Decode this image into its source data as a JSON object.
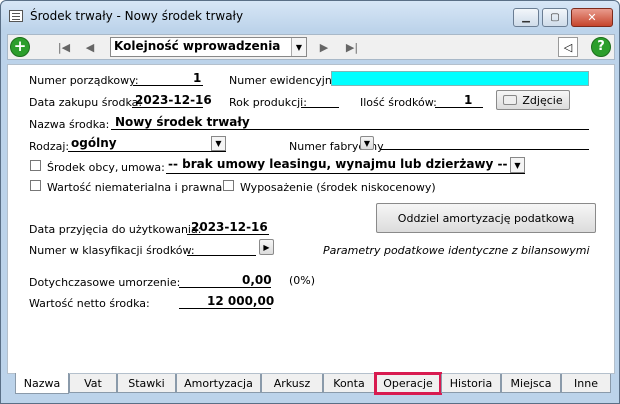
{
  "window": {
    "title": "Środek trwały - Nowy środek trwały",
    "min_label": "▁",
    "max_label": "▢",
    "close_label": "✕"
  },
  "toolbar": {
    "add_icon": "plus-icon",
    "first": "|◀",
    "prev": "◀",
    "sort_value": "Kolejność wprowadzenia",
    "next": "▶",
    "last": "▶|",
    "collapse": "◁",
    "help": "?"
  },
  "form": {
    "numer_porzadkowy_label": "Numer porządkowy:",
    "numer_porzadkowy_value": "1",
    "numer_ewidencyjny_label": "Numer ewidencyjny:",
    "numer_ewidencyjny_value": "",
    "data_zakupu_label": "Data zakupu środka:",
    "data_zakupu_value": "2023-12-16",
    "rok_produkcji_label": "Rok produkcji:",
    "rok_produkcji_value": "",
    "ilosc_label": "Ilość środków:",
    "ilosc_value": "1",
    "zdjecie_label": "Zdjęcie",
    "nazwa_label": "Nazwa środka:",
    "nazwa_value": "Nowy środek trwały",
    "rodzaj_label": "Rodzaj:",
    "rodzaj_value": "ogólny",
    "numer_fabryczny_label": "Numer fabryczny",
    "numer_fabryczny_value": "",
    "srodek_obcy_label": "Środek obcy,",
    "umowa_label": "umowa:",
    "umowa_value": "-- brak umowy leasingu, wynajmu lub dzierżawy --",
    "wartosc_niem_label": "Wartość niematerialna i prawna",
    "wyposazenie_label": "Wyposażenie (środek niskocenowy)",
    "data_przyjecia_label": "Data przyjęcia do użytkowania:",
    "data_przyjecia_value": "2023-12-16",
    "oddziel_label": "Oddziel amortyzację podatkową",
    "klasyfikacja_label": "Numer w klasyfikacji środków:",
    "klasyfikacja_value": "",
    "parametry_text": "Parametry podatkowe identyczne z bilansowymi",
    "umorzenie_label": "Dotychczasowe umorzenie:",
    "umorzenie_value": "0,00",
    "umorzenie_pct": "(0%)",
    "netto_label": "Wartość netto środka:",
    "netto_value": "12 000,00"
  },
  "tabs": [
    "Nazwa",
    "Vat",
    "Stawki",
    "Amortyzacja",
    "Arkusz",
    "Konta",
    "Operacje",
    "Historia",
    "Miejsca",
    "Inne"
  ],
  "colors": {
    "accent_highlight": "#d81b50",
    "cyan_field": "#00ffff",
    "green_button": "#2c9e2c"
  }
}
